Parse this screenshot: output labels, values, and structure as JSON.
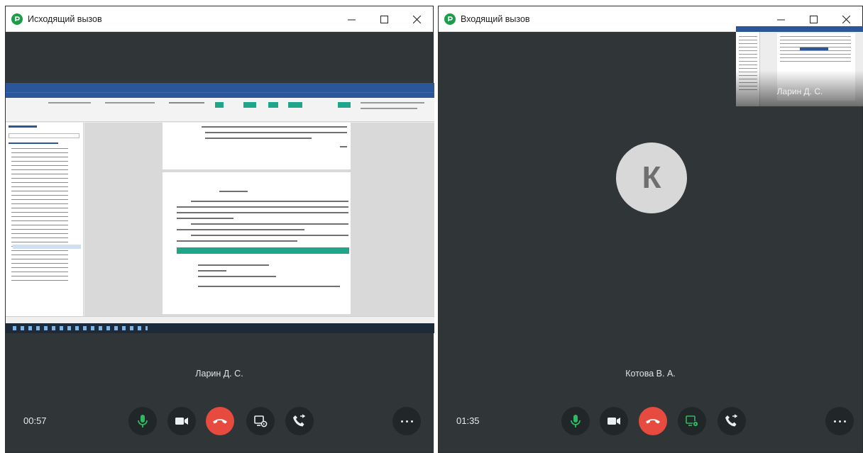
{
  "left_window": {
    "title": "Исходящий вызов",
    "caller_name": "Ларин Д. С.",
    "timer": "00:57",
    "controls": [
      {
        "name": "mic",
        "icon": "microphone-icon",
        "active": true
      },
      {
        "name": "camera",
        "icon": "video-camera-icon",
        "active": false
      },
      {
        "name": "end-call",
        "icon": "phone-hangup-icon",
        "color": "#e74b3f"
      },
      {
        "name": "screen-share",
        "icon": "screen-share-icon",
        "active": false
      },
      {
        "name": "transfer",
        "icon": "call-transfer-icon",
        "active": false
      }
    ],
    "more_icon": "more-dots-icon"
  },
  "right_window": {
    "title": "Входящий вызов",
    "caller_name": "Котова В. А.",
    "avatar_letter": "К",
    "self_preview_name": "Ларин Д. С.",
    "timer": "01:35",
    "controls": [
      {
        "name": "mic",
        "icon": "microphone-icon",
        "active": true
      },
      {
        "name": "camera",
        "icon": "video-camera-icon",
        "active": false
      },
      {
        "name": "end-call",
        "icon": "phone-hangup-icon",
        "color": "#e74b3f"
      },
      {
        "name": "screen-share",
        "icon": "screen-share-icon",
        "active": true
      },
      {
        "name": "transfer",
        "icon": "call-transfer-icon",
        "active": false
      }
    ],
    "more_icon": "more-dots-icon"
  },
  "colors": {
    "accent_green": "#2fb860",
    "end_call_red": "#e74b3f",
    "window_bg": "#303538",
    "button_bg": "#212629"
  }
}
